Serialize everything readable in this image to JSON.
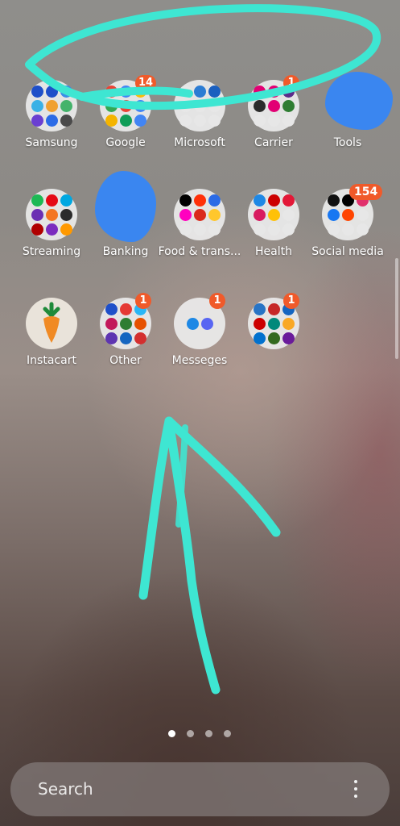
{
  "colors": {
    "badge": "#f05a2a",
    "annotation_stroke": "#3ee6d2",
    "redaction": "#3a86f0"
  },
  "rows": [
    {
      "apps": [
        {
          "label": "Samsung",
          "badge": "",
          "icon": "samsung-folder-icon",
          "minis": [
            "#1e4fc9",
            "#1e4fc9",
            "#3a8de6",
            "#3ab1e6",
            "#f0a030",
            "#44b36b",
            "#6a3fd1",
            "#2b6be6",
            "#4a4a4a"
          ]
        },
        {
          "label": "Google",
          "badge": "14",
          "icon": "google-folder-icon",
          "minis": [
            "#ea4335",
            "#4285f4",
            "#fbbc05",
            "#34a853",
            "#ea4335",
            "#4285f4",
            "#f4b400",
            "#0f9d58",
            "#4285f4"
          ]
        },
        {
          "label": "Microsoft",
          "badge": "",
          "icon": "microsoft-folder-icon",
          "minis": [
            "#e7e7e7",
            "#2b7cd3",
            "#1a5fbf",
            "#e7e7e7",
            "#e7e7e7",
            "#e7e7e7",
            "#e7e7e7",
            "#e7e7e7",
            "#e7e7e7"
          ]
        },
        {
          "label": "Carrier",
          "badge": "1",
          "icon": "carrier-folder-icon",
          "minis": [
            "#e20074",
            "#e20074",
            "#5b2b8a",
            "#2b2b2b",
            "#e20074",
            "#2e7d32",
            "#e7e7e7",
            "#e7e7e7",
            "#e7e7e7"
          ]
        },
        {
          "label": "Tools",
          "badge": "",
          "icon": "tools-folder-icon",
          "redacted": true,
          "minis": []
        }
      ]
    },
    {
      "apps": [
        {
          "label": "Streaming",
          "badge": "",
          "icon": "streaming-folder-icon",
          "minis": [
            "#1db954",
            "#e50914",
            "#00a8e1",
            "#6b2fb3",
            "#f47521",
            "#2b2b2b",
            "#b00000",
            "#7b2cbf",
            "#ff9900"
          ]
        },
        {
          "label": "Banking",
          "badge": "",
          "icon": "banking-folder-icon",
          "redacted": true,
          "minis": []
        },
        {
          "label": "Food & trans...",
          "badge": "",
          "icon": "food-folder-icon",
          "minis": [
            "#000000",
            "#ff3008",
            "#2b6be6",
            "#ff00bf",
            "#da291c",
            "#ffc72c",
            "#e7e7e7",
            "#e7e7e7",
            "#e7e7e7"
          ]
        },
        {
          "label": "Health",
          "badge": "",
          "icon": "health-folder-icon",
          "minis": [
            "#1e88e5",
            "#cc0000",
            "#e31837",
            "#d81b60",
            "#ffc107",
            "#e7e7e7",
            "#e7e7e7",
            "#e7e7e7",
            "#e7e7e7"
          ]
        },
        {
          "label": "Social media",
          "badge": "154",
          "icon": "social-media-folder-icon",
          "minis": [
            "#111111",
            "#000000",
            "#e1306c",
            "#1877f2",
            "#ff4500",
            "#e7e7e7",
            "#e7e7e7",
            "#e7e7e7",
            "#e7e7e7"
          ]
        }
      ]
    },
    {
      "apps": [
        {
          "label": "Instacart",
          "badge": "",
          "icon": "instacart-carrot-icon",
          "single": true,
          "minis": []
        },
        {
          "label": "Other",
          "badge": "1",
          "icon": "other-folder-icon",
          "minis": [
            "#1e4fc9",
            "#e53935",
            "#29b6f6",
            "#c2185b",
            "#2e7d32",
            "#e65100",
            "#5e35b1",
            "#1565c0",
            "#d32f2f"
          ]
        },
        {
          "label": "Messeges",
          "badge": "1",
          "icon": "messages-folder-icon",
          "two": true,
          "minis": [
            "#1e88e5",
            "#5865f2"
          ]
        },
        {
          "label": "",
          "badge": "1",
          "icon": "shopping-folder-icon",
          "minis": [
            "#2874c5",
            "#c62828",
            "#1565c0",
            "#cc0000",
            "#00897b",
            "#f9a825",
            "#0071ce",
            "#33691e",
            "#6a1b9a"
          ]
        }
      ]
    }
  ],
  "page_indicator": {
    "count": 4,
    "active": 1
  },
  "search": {
    "placeholder": "Search",
    "menu_icon": "more-vert-icon"
  }
}
